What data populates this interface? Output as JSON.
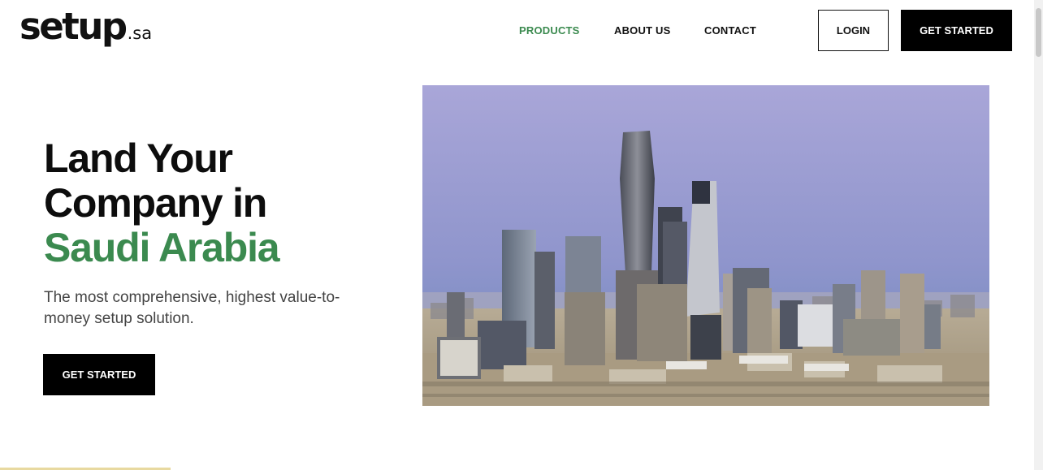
{
  "logo": {
    "main": "setup",
    "suffix": ".sa"
  },
  "nav": {
    "items": [
      {
        "label": "PRODUCTS",
        "active": true
      },
      {
        "label": "ABOUT US",
        "active": false
      },
      {
        "label": "CONTACT",
        "active": false
      }
    ],
    "login_label": "LOGIN",
    "cta_label": "GET STARTED"
  },
  "hero": {
    "title_line1": "Land Your",
    "title_line2": "Company in",
    "title_highlight": "Saudi Arabia",
    "subtitle": "The most comprehensive, highest value-to-money setup solution.",
    "cta_label": "GET STARTED"
  },
  "colors": {
    "accent_green": "#3b8a4f",
    "button_black": "#000000",
    "text_dark": "#111111"
  },
  "icons": {
    "hero_image": "riyadh-skyline-photo"
  }
}
